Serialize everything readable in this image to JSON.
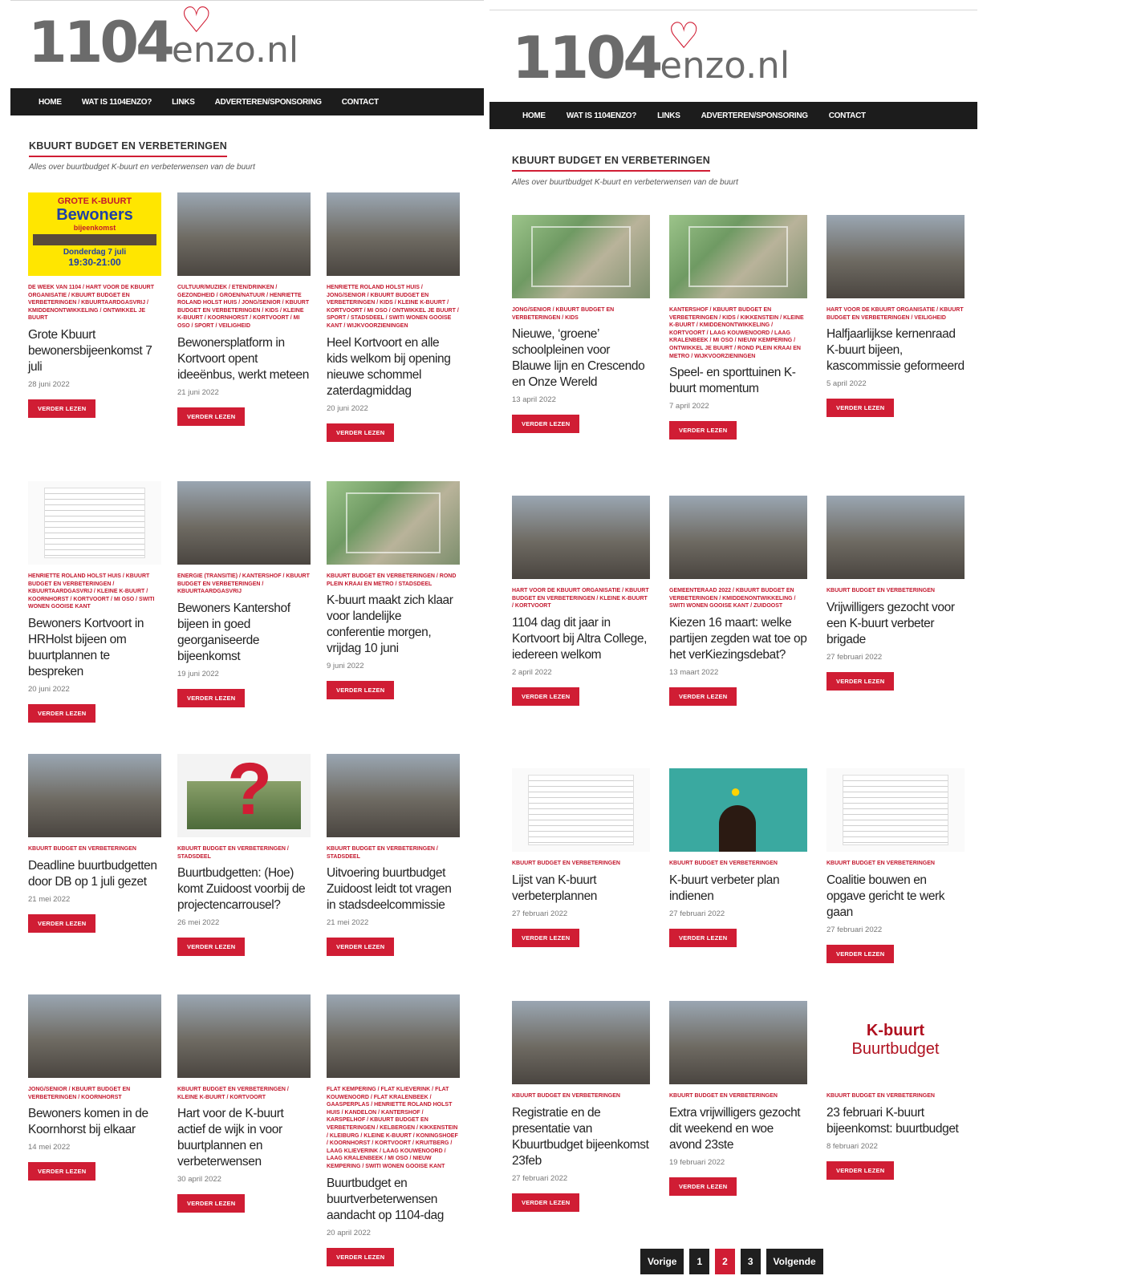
{
  "brand": {
    "number": "1104",
    "domain": "enzo.nl"
  },
  "nav": [
    "HOME",
    "WAT IS 1104ENZO?",
    "LINKS",
    "ADVERTEREN/SPONSORING",
    "CONTACT"
  ],
  "section": {
    "title": "KBUURT BUDGET EN VERBETERINGEN",
    "subtitle": "Alles over buurtbudget K-buurt en verbeterwensen van de buurt"
  },
  "read_more": "VERDER LEZEN",
  "colors": {
    "accent": "#d01d34",
    "nav_bg": "#1c1c1c",
    "logo_gray": "#6b6b6b"
  },
  "page1": {
    "posts": [
      {
        "image": "poster",
        "image_text": [
          "GROTE K-BUURT",
          "Bewoners",
          "bijeenkomst",
          "Donderdag 7 juli",
          "19:30-21:00"
        ],
        "categories": "DE WEEK VAN 1104 / HART VOOR DE KBUURT ORGANISATIE / KBUURT BUDGET EN VERBETERINGEN / KBUURTAARDGASVRIJ / KMIDDENONTWIKKELING / ONTWIKKEL JE BUURT",
        "title": "Grote Kbuurt bewonersbijeenkomst 7 juli",
        "date": "28 juni 2022"
      },
      {
        "image": "photo",
        "categories": "CULTUUR/MUZIEK / ETEN/DRINKEN / GEZONDHEID / GROEN/NATUUR / HENRIETTE ROLAND HOLST HUIS / JONG/SENIOR / KBUURT BUDGET EN VERBETERINGEN / KIDS / KLEINE K-BUURT / KOORNHORST / KORTVOORT / MI OSO / SPORT / VEILIGHEID",
        "title": "Bewonersplatform in Kortvoort opent ideeënbus, werkt meteen",
        "date": "21 juni 2022"
      },
      {
        "image": "photo",
        "categories": "HENRIETTE ROLAND HOLST HUIS / JONG/SENIOR / KBUURT BUDGET EN VERBETERINGEN / KIDS / KLEINE K-BUURT / KORTVOORT / MI OSO / ONTWIKKEL JE BUURT / SPORT / STADSDEEL / SWITI WONEN GOOISE KANT / WIJKVOORZIENINGEN",
        "title": "Heel Kortvoort en alle kids welkom bij opening nieuwe schommel zaterdagmiddag",
        "date": "20 juni 2022"
      },
      {
        "image": "doc",
        "categories": "HENRIETTE ROLAND HOLST HUIS / KBUURT BUDGET EN VERBETERINGEN / KBUURTAARDGASVRIJ / KLEINE K-BUURT / KOORNHORST / KORTVOORT / MI OSO / SWITI WONEN GOOISE KANT",
        "title": "Bewoners Kortvoort in HRHolst bijeen om buurtplannen te bespreken",
        "date": "20 juni 2022"
      },
      {
        "image": "photo",
        "categories": "ENERGIE (TRANSITIE) / KANTERSHOF / KBUURT BUDGET EN VERBETERINGEN / KBUURTAARDGASVRIJ",
        "title": "Bewoners Kantershof bijeen in goed georganiseerde bijeenkomst",
        "date": "19 juni 2022"
      },
      {
        "image": "map",
        "categories": "KBUURT BUDGET EN VERBETERINGEN / ROND PLEIN KRAAI EN METRO / STADSDEEL",
        "title": "K-buurt maakt zich klaar voor landelijke conferentie morgen, vrijdag 10 juni",
        "date": "9 juni 2022"
      },
      {
        "image": "photo",
        "categories": "KBUURT BUDGET EN VERBETERINGEN",
        "title": "Deadline buurtbudgetten door DB op 1 juli gezet",
        "date": "21 mei 2022"
      },
      {
        "image": "question",
        "categories": "KBUURT BUDGET EN VERBETERINGEN / STADSDEEL",
        "title": "Buurtbudgetten: (Hoe) komt Zuidoost voorbij de projectencarrousel?",
        "date": "26 mei 2022"
      },
      {
        "image": "photo",
        "categories": "KBUURT BUDGET EN VERBETERINGEN / STADSDEEL",
        "title": "Uitvoering buurtbudget Zuidoost leidt tot vragen in stadsdeelcommissie",
        "date": "21 mei 2022"
      },
      {
        "image": "photo",
        "categories": "JONG/SENIOR / KBUURT BUDGET EN VERBETERINGEN / KOORNHORST",
        "title": "Bewoners komen in de Koornhorst bij elkaar",
        "date": "14 mei 2022"
      },
      {
        "image": "photo",
        "categories": "KBUURT BUDGET EN VERBETERINGEN / KLEINE K-BUURT / KORTVOORT",
        "title": "Hart voor de K-buurt actief de wijk in voor buurtplannen en verbeterwensen",
        "date": "30 april 2022"
      },
      {
        "image": "photo",
        "categories": "FLAT KEMPERING / FLAT KLIEVERINK / FLAT KOUWENOORD / FLAT KRALENBEEK / GAASPERPLAS / HENRIETTE ROLAND HOLST HUIS / KANDELON / KANTERSHOF / KARSPELHOF / KBUURT BUDGET EN VERBETERINGEN / KELBERGEN / KIKKENSTEIN / KLEIBURG / KLEINE K-BUURT / KONINGSHOEF / KOORNHORST / KORTVOORT / KRUITBERG / LAAG KLIEVERINK / LAAG KOUWENOORD / LAAG KRALENBEEK / MI OSO / NIEUW KEMPERING / SWITI WONEN GOOISE KANT",
        "title": "Buurtbudget en buurtverbeterwensen aandacht op 1104-dag",
        "date": "20 april 2022"
      }
    ]
  },
  "page2": {
    "posts": [
      {
        "image": "map",
        "categories": "JONG/SENIOR / KBUURT BUDGET EN VERBETERINGEN / KIDS",
        "title": "Nieuwe, ‘groene’ schoolpleinen voor Blauwe lijn en Crescendo en Onze Wereld",
        "date": "13 april 2022"
      },
      {
        "image": "map",
        "categories": "KANTERSHOF / KBUURT BUDGET EN VERBETERINGEN / KIDS / KIKKENSTEIN / KLEINE K-BUURT / KMIDDENONTWIKKELING / KORTVOORT / LAAG KOUWENOORD / LAAG KRALENBEEK / MI OSO / NIEUW KEMPERING / ONTWIKKEL JE BUURT / ROND PLEIN KRAAI EN METRO / WIJKVOORZIENINGEN",
        "title": "Speel- en sporttuinen K-buurt momentum",
        "date": "7 april 2022"
      },
      {
        "image": "photo",
        "categories": "HART VOOR DE KBUURT ORGANISATIE / KBUURT BUDGET EN VERBETERINGEN / VEILIGHEID",
        "title": "Halfjaarlijkse kernenraad K-buurt bijeen, kascommissie geformeerd",
        "date": "5 april 2022"
      },
      {
        "image": "photo",
        "categories": "HART VOOR DE KBUURT ORGANISATIE / KBUURT BUDGET EN VERBETERINGEN / KLEINE K-BUURT / KORTVOORT",
        "title": "1104 dag dit jaar in Kortvoort bij Altra College, iedereen welkom",
        "date": "2 april 2022"
      },
      {
        "image": "photo",
        "categories": "GEMEENTERAAD 2022 / KBUURT BUDGET EN VERBETERINGEN / KMIDDENONTWIKKELING / SWITI WONEN GOOISE KANT / ZUIDOOST",
        "title": "Kiezen 16 maart: welke partijen zegden wat toe op het verKiezingsdebat?",
        "date": "13 maart 2022"
      },
      {
        "image": "photo",
        "categories": "KBUURT BUDGET EN VERBETERINGEN",
        "title": "Vrijwilligers gezocht voor een K-buurt verbeter brigade",
        "date": "27 februari 2022"
      },
      {
        "image": "doc",
        "categories": "KBUURT BUDGET EN VERBETERINGEN",
        "title": "Lijst van K-buurt verbeterplannen",
        "date": "27 februari 2022"
      },
      {
        "image": "teal",
        "categories": "KBUURT BUDGET EN VERBETERINGEN",
        "title": "K-buurt verbeter plan indienen",
        "date": "27 februari 2022"
      },
      {
        "image": "doc",
        "categories": "KBUURT BUDGET EN VERBETERINGEN",
        "title": "Coalitie bouwen en opgave gericht te werk gaan",
        "date": "27 februari 2022"
      },
      {
        "image": "photo",
        "categories": "KBUURT BUDGET EN VERBETERINGEN",
        "title": "Registratie en de presentatie van Kbuurtbudget bijeenkomst 23feb",
        "date": "27 februari 2022"
      },
      {
        "image": "photo",
        "categories": "KBUURT BUDGET EN VERBETERINGEN",
        "title": "Extra vrijwilligers gezocht dit weekend en woe avond 23ste",
        "date": "19 februari 2022"
      },
      {
        "image": "text",
        "image_text": [
          "K-buurt",
          "Buurtbudget"
        ],
        "categories": "KBUURT BUDGET EN VERBETERINGEN",
        "title": "23 februari K-buurt bijeenkomst: buurtbudget",
        "date": "8 februari 2022"
      }
    ],
    "pagination": {
      "prev": "Vorige",
      "pages": [
        "1",
        "2",
        "3"
      ],
      "current": "2",
      "next": "Volgende"
    }
  }
}
